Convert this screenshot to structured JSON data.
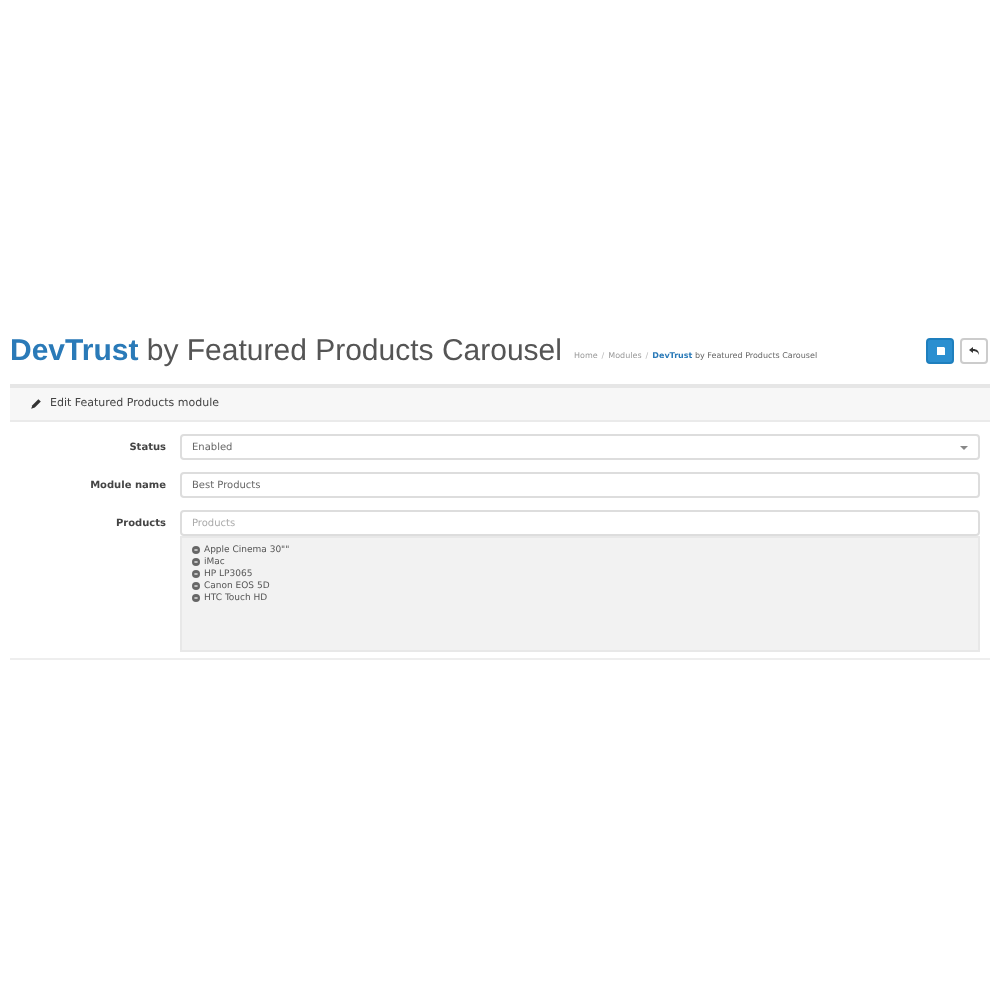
{
  "page_title": {
    "brand": "DevTrust",
    "rest": "by Featured Products Carousel"
  },
  "breadcrumb": [
    {
      "label": "Home",
      "current": false
    },
    {
      "separator": "/",
      "label": "Modules",
      "current": false
    },
    {
      "separator": "/",
      "label": "**DevTrust** by Featured Products Carousel",
      "current": true
    }
  ],
  "panel": {
    "heading": "Edit Featured Products module",
    "fields": [
      {
        "kind": "select",
        "label": "Status",
        "value": "Enabled"
      },
      {
        "kind": "text",
        "label": "Module name",
        "value": "Best Products"
      },
      {
        "kind": "autocomplete",
        "label": "Products",
        "placeholder": "Products",
        "items": [
          "Apple Cinema 30\"\"",
          "iMac",
          "HP LP3065",
          "Canon EOS 5D",
          "HTC Touch HD"
        ]
      }
    ]
  }
}
